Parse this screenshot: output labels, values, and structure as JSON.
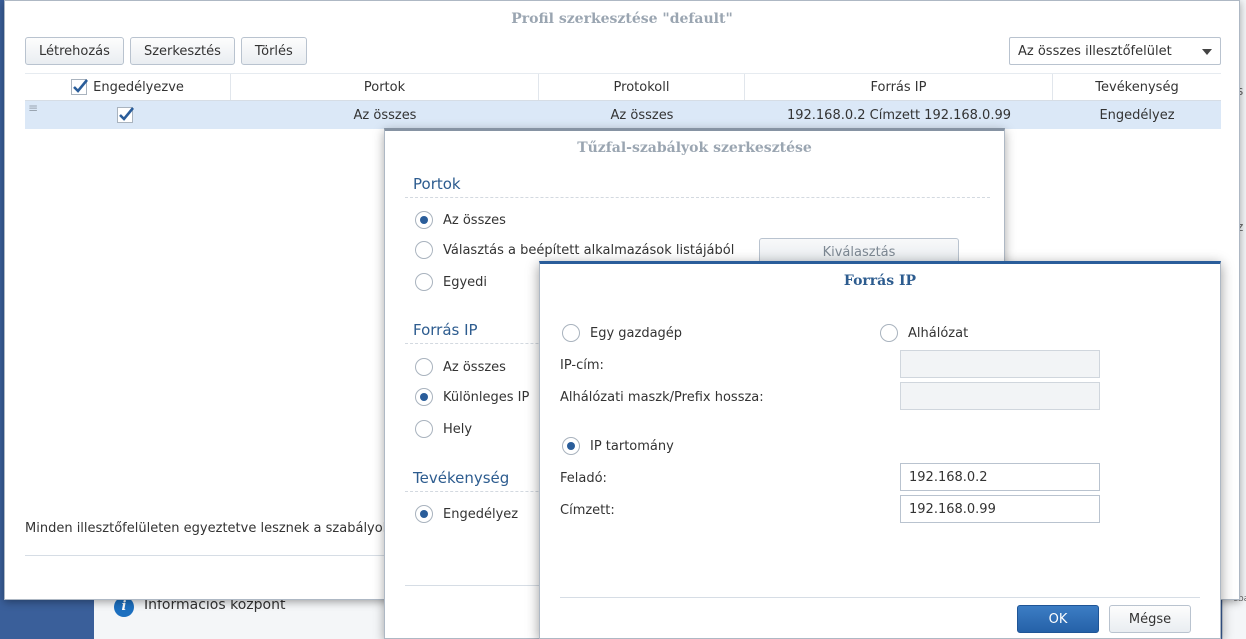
{
  "background": {
    "taskbar_label": "Információs központ",
    "right_fragment_1": "s",
    "right_fragment_2": "z",
    "right_fragment_3": "cba"
  },
  "profile_window": {
    "title": "Profil szerkesztése \"default\"",
    "toolbar": {
      "create": "Létrehozás",
      "edit": "Szerkesztés",
      "delete": "Törlés"
    },
    "interface_select": "Az összes illesztőfelület",
    "columns": {
      "enabled": "Engedélyezve",
      "ports": "Portok",
      "protocol": "Protokoll",
      "source_ip": "Forrás IP",
      "action": "Tevékenység"
    },
    "rows": [
      {
        "enabled": true,
        "ports": "Az összes",
        "protocol": "Az összes",
        "source_ip": "192.168.0.2 Címzett 192.168.0.99",
        "action": "Engedélyez"
      }
    ],
    "footer_text": "Minden illesztőfelületen egyeztetve lesznek a szabályok,"
  },
  "rules_dialog": {
    "title": "Tűzfal-szabályok szerkesztése",
    "ports": {
      "heading": "Portok",
      "option_all": "Az összes",
      "option_builtin": "Választás a beépített alkalmazások listájából",
      "option_custom": "Egyedi",
      "select_button": "Kiválasztás",
      "selected": "all"
    },
    "source_ip": {
      "heading": "Forrás IP",
      "option_all": "Az összes",
      "option_specific": "Különleges IP",
      "option_location": "Hely",
      "selected": "specific"
    },
    "action": {
      "heading": "Tevékenység",
      "option_allow": "Engedélyez",
      "selected": "allow"
    }
  },
  "source_dialog": {
    "title": "Forrás IP",
    "single_host": "Egy gazdagép",
    "subnet": "Alhálózat",
    "ip_label": "IP-cím:",
    "mask_label": "Alhálózati maszk/Prefix hossza:",
    "ip_range": "IP tartomány",
    "from_label": "Feladó:",
    "from_value": "192.168.0.2",
    "to_label": "Címzett:",
    "to_value": "192.168.0.99",
    "selected": "ip_range",
    "ok": "OK",
    "cancel": "Mégse"
  },
  "colors": {
    "accent": "#2a5d9a",
    "selected_row": "#dbe8f7",
    "section_title": "#2d5c8f"
  }
}
